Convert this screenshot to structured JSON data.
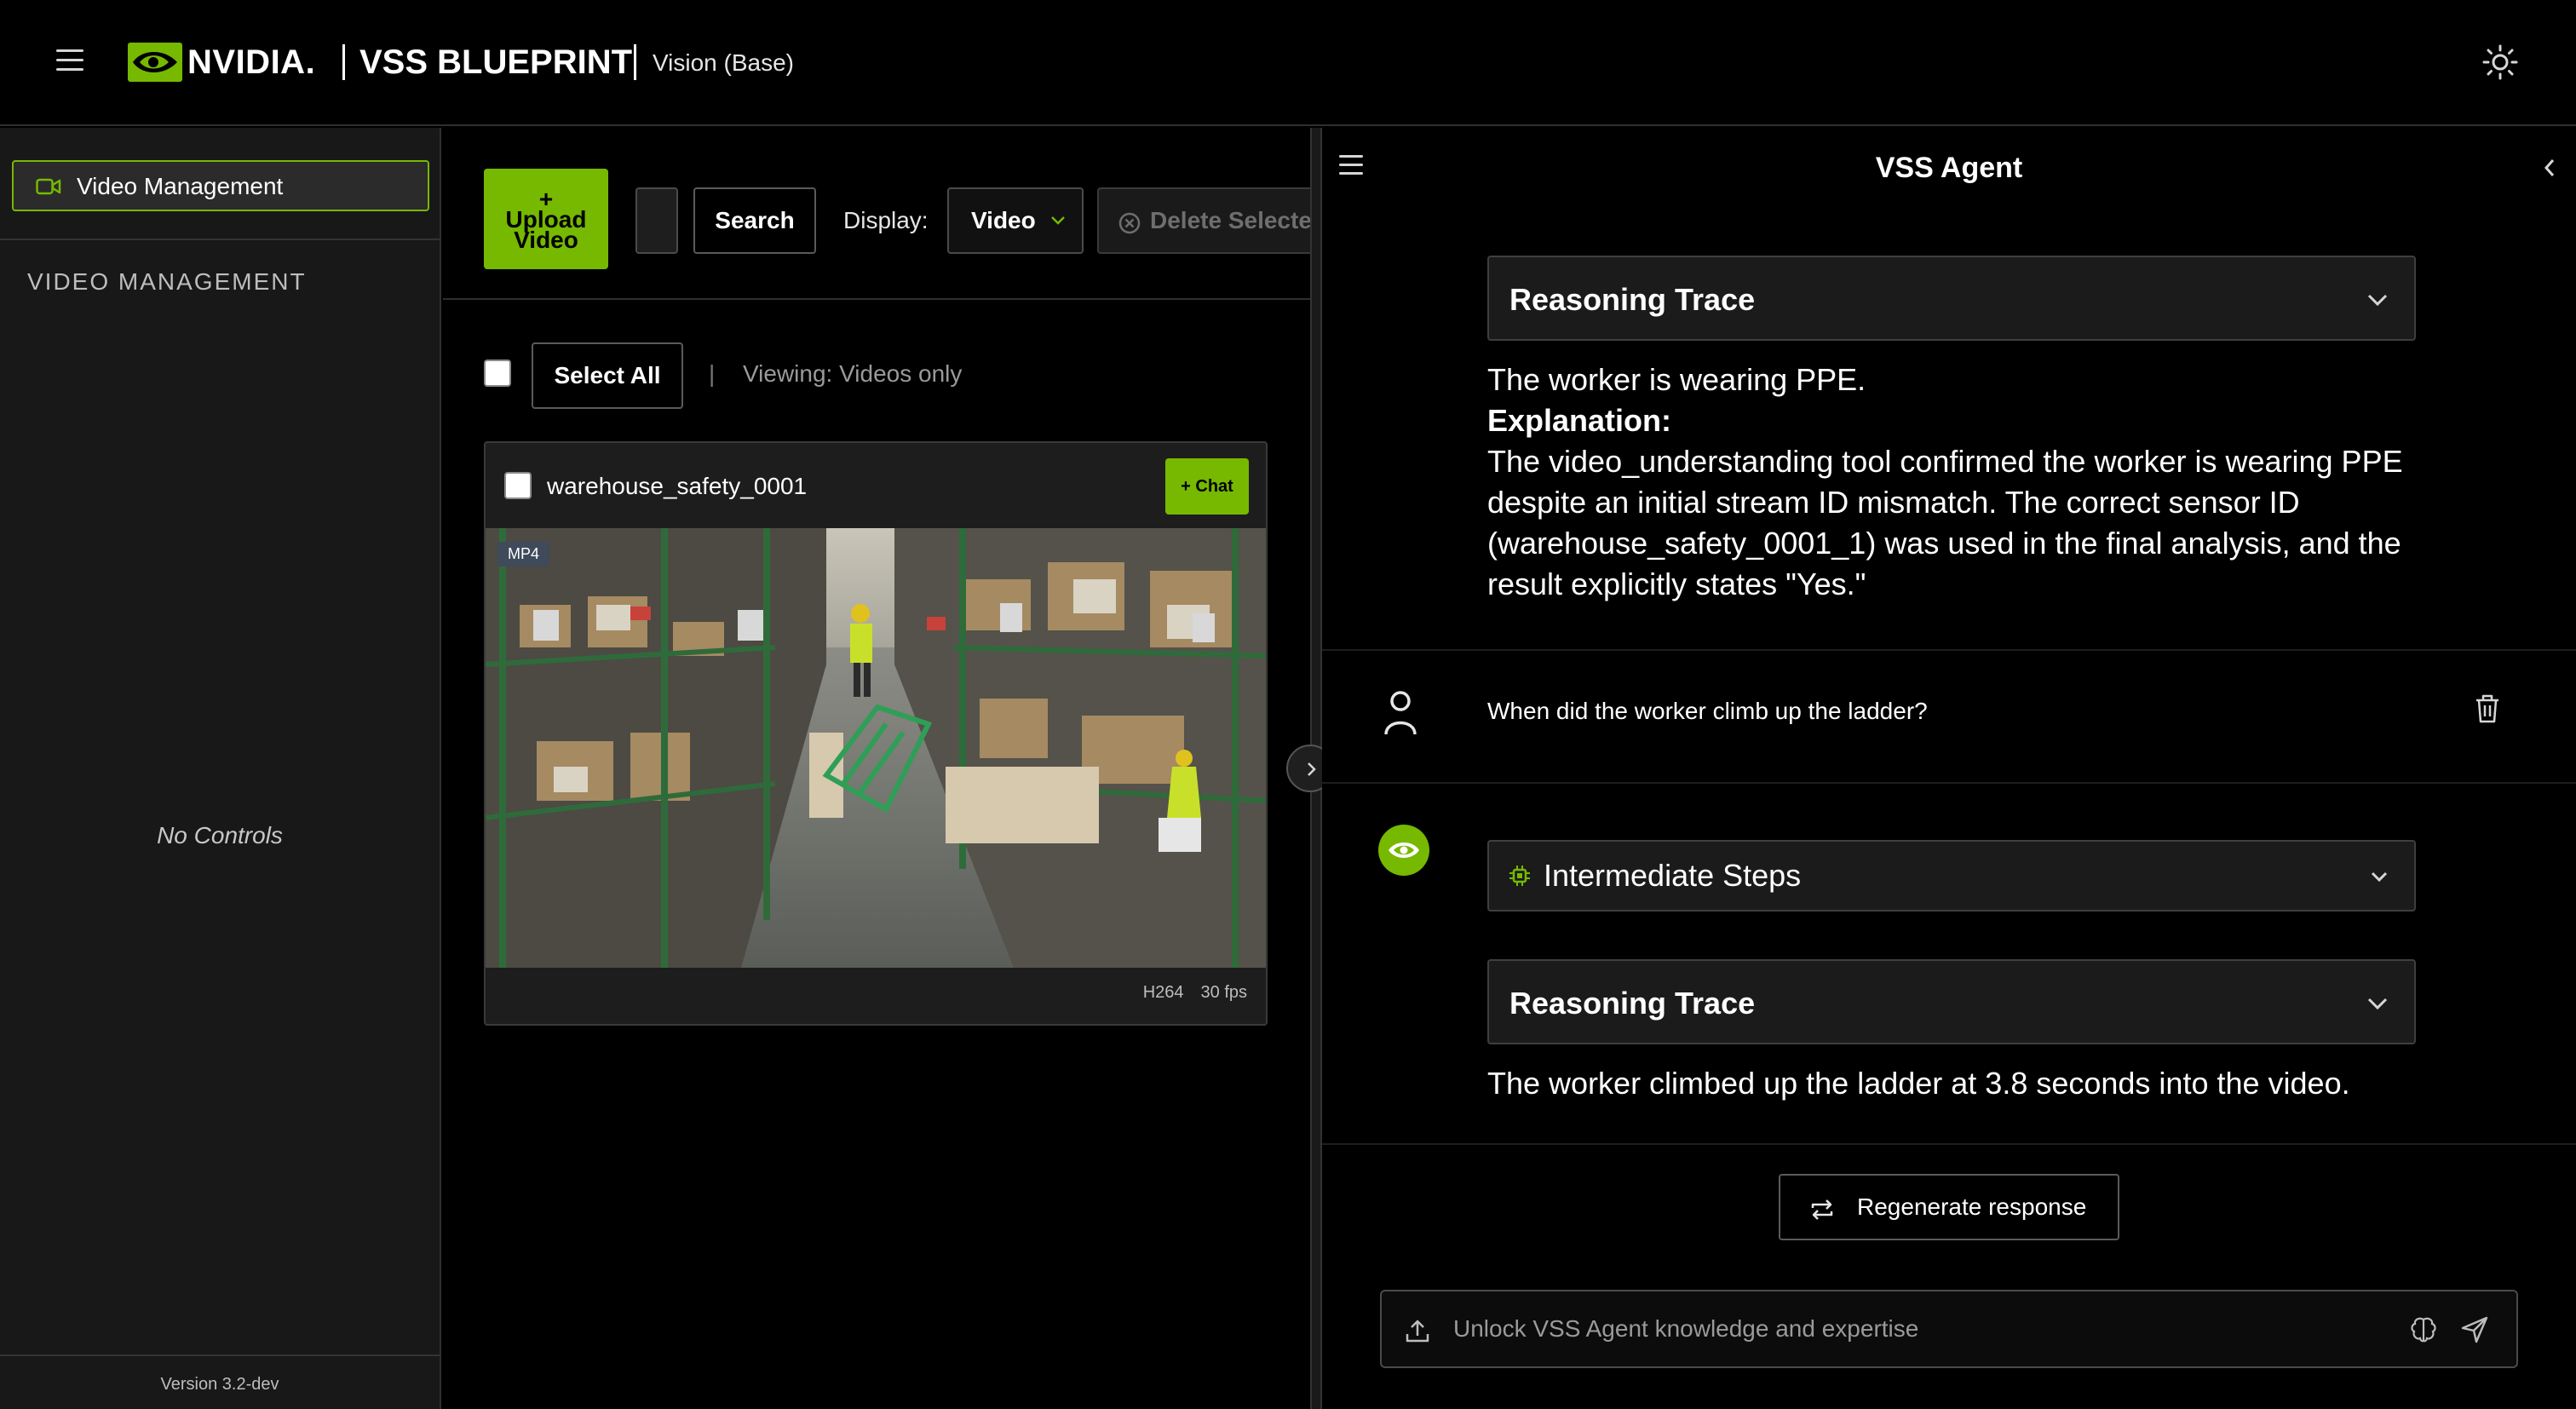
{
  "header": {
    "brand": "NVIDIA.",
    "product": "VSS BLUEPRINT",
    "subtitle": "Vision (Base)"
  },
  "colors": {
    "accent": "#76b900",
    "background": "#000000",
    "panel": "#181818"
  },
  "sidebar": {
    "nav_item": "Video Management",
    "section_heading": "VIDEO MANAGEMENT",
    "empty_text": "No Controls",
    "version": "Version 3.2-dev"
  },
  "toolbar": {
    "upload_plus": "+",
    "upload_line1": "Upload",
    "upload_line2": "Video",
    "search_label": "Search",
    "search_value": "",
    "display_label": "Display:",
    "display_value": "Video",
    "delete_label": "Delete Selected"
  },
  "list": {
    "select_all": "Select All",
    "separator": "|",
    "viewing": "Viewing: Videos only",
    "videos": [
      {
        "name": "warehouse_safety_0001",
        "chat_label": "+ Chat",
        "format": "MP4",
        "codec": "H264",
        "fps": "30 fps"
      }
    ]
  },
  "chat": {
    "title": "VSS Agent",
    "reasoning_label": "Reasoning Trace",
    "intermediate_label": "Intermediate Steps",
    "answer1_line1": "The worker is wearing PPE.",
    "answer1_heading": "Explanation:",
    "answer1_body": "The video_understanding tool confirmed the worker is wearing PPE despite an initial stream ID mismatch. The correct sensor ID (warehouse_safety_0001_1) was used in the final analysis, and the result explicitly states \"Yes.\"",
    "user_question": "When did the worker climb up the ladder?",
    "answer2": "The worker climbed up the ladder at 3.8 seconds into the video.",
    "regenerate_label": "Regenerate response",
    "input_placeholder": "Unlock VSS Agent knowledge and expertise"
  },
  "icons": [
    "hamburger-icon",
    "nvidia-eye-icon",
    "sun-icon",
    "camera-icon",
    "x-circle-icon",
    "chevron-down-icon",
    "chevron-right-icon",
    "chevron-left-icon",
    "user-icon",
    "trash-icon",
    "chip-icon",
    "refresh-icon",
    "upload-icon",
    "brain-icon",
    "send-icon"
  ]
}
